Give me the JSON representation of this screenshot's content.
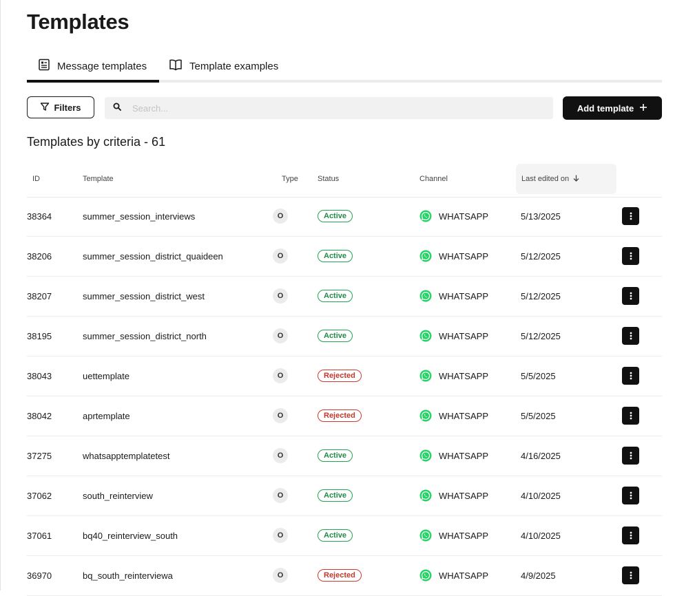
{
  "page": {
    "title": "Templates"
  },
  "tabs": [
    {
      "label": "Message templates",
      "icon": "list-document-icon"
    },
    {
      "label": "Template examples",
      "icon": "open-book-icon"
    }
  ],
  "toolbar": {
    "filters_label": "Filters",
    "search_placeholder": "Search...",
    "add_label": "Add template"
  },
  "summary": {
    "criteria_text": "Templates by criteria - 61"
  },
  "table": {
    "columns": {
      "id": "ID",
      "template": "Template",
      "type": "Type",
      "status": "Status",
      "channel": "Channel",
      "last_edited": "Last edited on"
    },
    "rows": [
      {
        "id": "38364",
        "template": "summer_session_interviews",
        "type": "O",
        "status": "Active",
        "channel": "WHATSAPP",
        "last_edited": "5/13/2025"
      },
      {
        "id": "38206",
        "template": "summer_session_district_quaideen",
        "type": "O",
        "status": "Active",
        "channel": "WHATSAPP",
        "last_edited": "5/12/2025"
      },
      {
        "id": "38207",
        "template": "summer_session_district_west",
        "type": "O",
        "status": "Active",
        "channel": "WHATSAPP",
        "last_edited": "5/12/2025"
      },
      {
        "id": "38195",
        "template": "summer_session_district_north",
        "type": "O",
        "status": "Active",
        "channel": "WHATSAPP",
        "last_edited": "5/12/2025"
      },
      {
        "id": "38043",
        "template": "uettemplate",
        "type": "O",
        "status": "Rejected",
        "channel": "WHATSAPP",
        "last_edited": "5/5/2025"
      },
      {
        "id": "38042",
        "template": "aprtemplate",
        "type": "O",
        "status": "Rejected",
        "channel": "WHATSAPP",
        "last_edited": "5/5/2025"
      },
      {
        "id": "37275",
        "template": "whatsapptemplatetest",
        "type": "O",
        "status": "Active",
        "channel": "WHATSAPP",
        "last_edited": "4/16/2025"
      },
      {
        "id": "37062",
        "template": "south_reinterview",
        "type": "O",
        "status": "Active",
        "channel": "WHATSAPP",
        "last_edited": "4/10/2025"
      },
      {
        "id": "37061",
        "template": "bq40_reinterview_south",
        "type": "O",
        "status": "Active",
        "channel": "WHATSAPP",
        "last_edited": "4/10/2025"
      },
      {
        "id": "36970",
        "template": "bq_south_reinterviewa",
        "type": "O",
        "status": "Rejected",
        "channel": "WHATSAPP",
        "last_edited": "4/9/2025"
      }
    ]
  },
  "colors": {
    "active": "#1e8c45",
    "rejected": "#c4352a",
    "whatsapp": "#25d366",
    "primary": "#111111"
  }
}
